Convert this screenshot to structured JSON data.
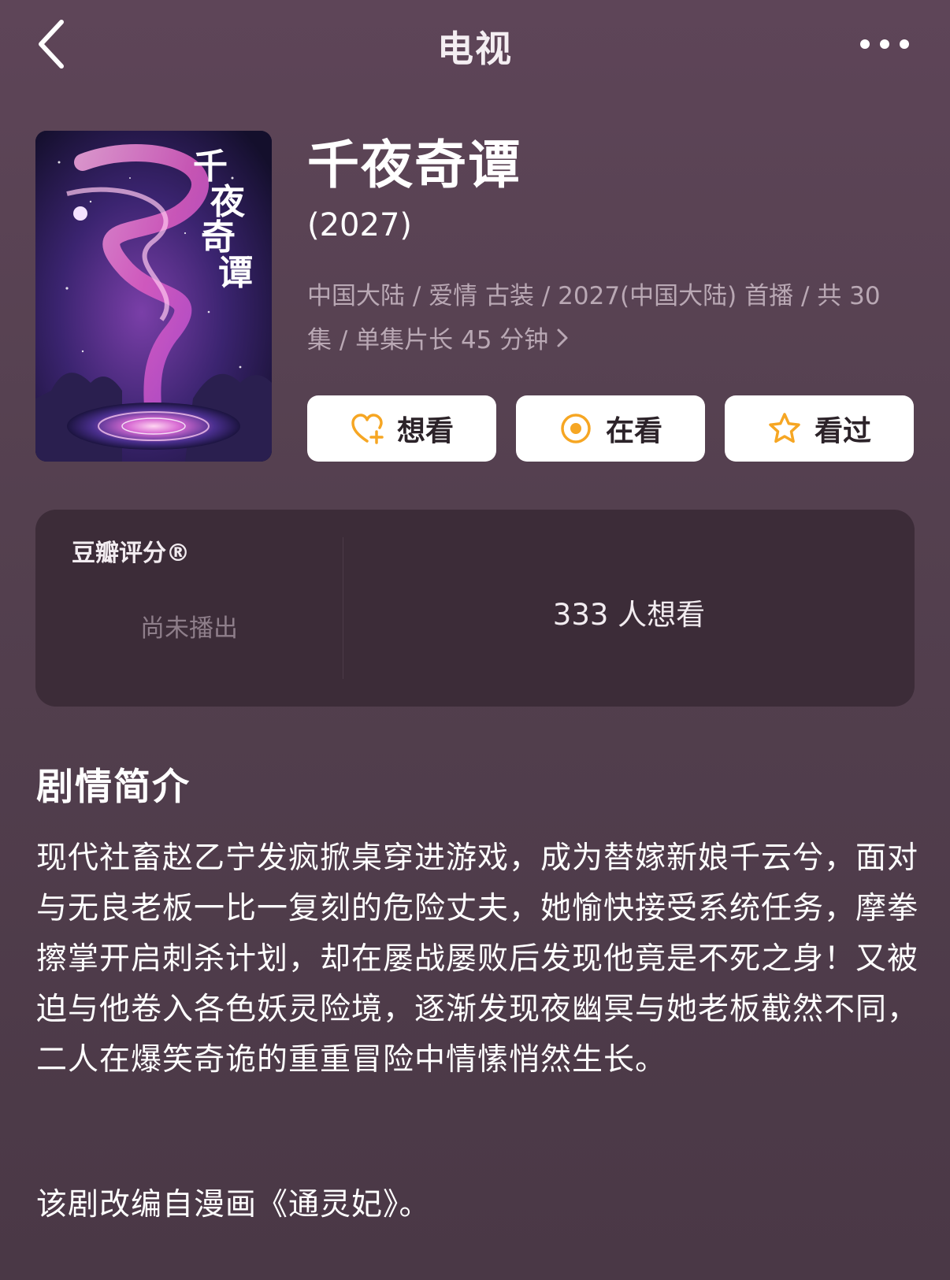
{
  "nav": {
    "back_icon": "chevron-left-icon",
    "title": "电视",
    "more_icon": "more-dots-icon"
  },
  "poster": {
    "title_text": "千夜奇谭"
  },
  "show": {
    "title": "千夜奇谭",
    "year": " (2027)",
    "meta": "中国大陆 / 爱情 古装 / 2027(中国大陆) 首播 / 共 30 集 / 单集片长 45 分钟"
  },
  "actions": {
    "want": {
      "label": "想看",
      "icon": "heart-plus-icon"
    },
    "watching": {
      "label": "在看",
      "icon": "target-icon"
    },
    "watched": {
      "label": "看过",
      "icon": "star-icon"
    },
    "accent_color": "#f6a623"
  },
  "rating": {
    "label": "豆瓣评分®",
    "status": "尚未播出",
    "want_count": "333 人想看"
  },
  "synopsis": {
    "title": "剧情简介",
    "body": "现代社畜赵乙宁发疯掀桌穿进游戏，成为替嫁新娘千云兮，面对与无良老板一比一复刻的危险丈夫，她愉快接受系统任务，摩拳擦掌开启刺杀计划，却在屡战屡败后发现他竟是不死之身！又被迫与他卷入各色妖灵险境，逐渐发现夜幽冥与她老板截然不同，二人在爆笑奇诡的重重冒险中情愫悄然生长。",
    "note": "该剧改编自漫画《通灵妃》。"
  }
}
